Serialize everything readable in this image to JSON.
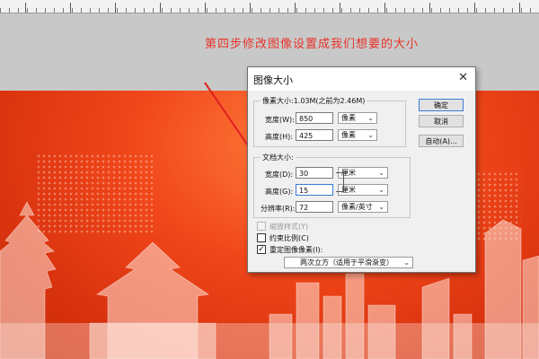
{
  "instruction": "第四步修改图像设置成我们想要的大小",
  "dialog": {
    "title": "图像大小",
    "close_icon": "close-icon",
    "pixel_group": {
      "label": "像素大小:1.03M(之前为2.46M)",
      "width_label": "宽度(W):",
      "width_value": "850",
      "width_unit": "像素",
      "height_label": "高度(H):",
      "height_value": "425",
      "height_unit": "像素"
    },
    "doc_group": {
      "label": "文档大小:",
      "width_label": "宽度(D):",
      "width_value": "30",
      "width_unit": "厘米",
      "height_label": "高度(G):",
      "height_value": "15",
      "height_unit": "厘米",
      "res_label": "分辨率(R):",
      "res_value": "72",
      "res_unit": "像素/英寸"
    },
    "buttons": {
      "ok": "确定",
      "cancel": "取消",
      "auto": "自动(A)..."
    },
    "checkboxes": {
      "scale_styles": "缩放样式(Y)",
      "constrain": "约束比例(C)",
      "resample": "重定图像像素(I):"
    },
    "resample_method": "两次立方（适用于平滑渐变）"
  },
  "colors": {
    "banner": "#e8401a",
    "instruction_text": "#e8332a",
    "arrow": "#e02020"
  }
}
